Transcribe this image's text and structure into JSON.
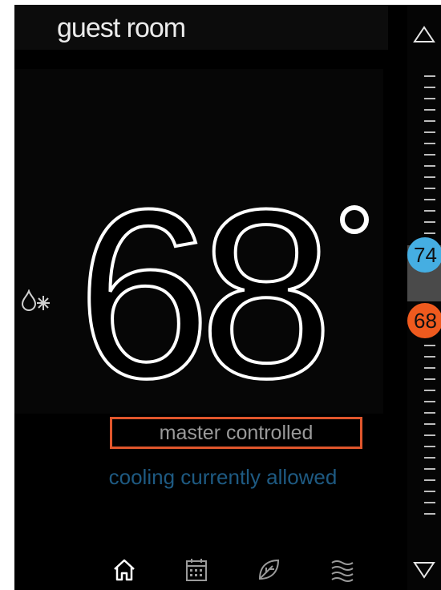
{
  "room": {
    "name": "guest room"
  },
  "temperature": {
    "value": "68"
  },
  "status": {
    "control": "master controlled",
    "mode_message": "cooling currently allowed"
  },
  "setpoints": {
    "cool": "74",
    "heat": "68"
  },
  "icons": {
    "mode": "cool-mode-icon",
    "up": "triangle-up-icon",
    "down": "triangle-down-icon",
    "nav": [
      "home-icon",
      "calendar-icon",
      "leaf-icon",
      "fan-icon"
    ]
  },
  "colors": {
    "accent_orange": "#e0562c",
    "cool_blue": "#45aee2",
    "heat_orange": "#ef5a1e",
    "message_blue": "#1e5a82"
  }
}
